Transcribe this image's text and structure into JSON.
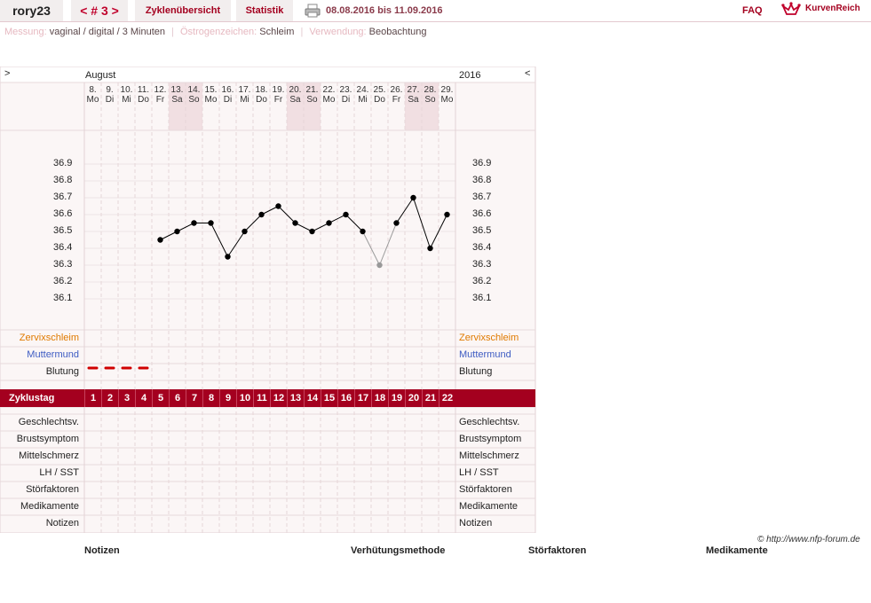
{
  "header": {
    "username": "rory23",
    "cycle_prev": "<",
    "cycle_label": "# 3",
    "cycle_next": ">",
    "tab_overview": "Zyklenübersicht",
    "tab_stats": "Statistik",
    "date_range": "08.08.2016 bis 11.09.2016",
    "faq": "FAQ",
    "brand": "KurvenReich"
  },
  "meta": {
    "measurement_label": "Messung:",
    "measurement_value": "vaginal / digital / 3 Minuten",
    "estrogen_label": "Östrogenzeichen:",
    "estrogen_value": "Schleim",
    "usage_label": "Verwendung:",
    "usage_value": "Beobachtung"
  },
  "chart": {
    "nav_left": ">",
    "nav_right": "<",
    "month": "August",
    "year": "2016",
    "days": [
      {
        "d": "8.",
        "w": "Mo",
        "we": false
      },
      {
        "d": "9.",
        "w": "Di",
        "we": false
      },
      {
        "d": "10.",
        "w": "Mi",
        "we": false
      },
      {
        "d": "11.",
        "w": "Do",
        "we": false
      },
      {
        "d": "12.",
        "w": "Fr",
        "we": false
      },
      {
        "d": "13.",
        "w": "Sa",
        "we": true
      },
      {
        "d": "14.",
        "w": "So",
        "we": true
      },
      {
        "d": "15.",
        "w": "Mo",
        "we": false
      },
      {
        "d": "16.",
        "w": "Di",
        "we": false
      },
      {
        "d": "17.",
        "w": "Mi",
        "we": false
      },
      {
        "d": "18.",
        "w": "Do",
        "we": false
      },
      {
        "d": "19.",
        "w": "Fr",
        "we": false
      },
      {
        "d": "20.",
        "w": "Sa",
        "we": true
      },
      {
        "d": "21.",
        "w": "So",
        "we": true
      },
      {
        "d": "22.",
        "w": "Mo",
        "we": false
      },
      {
        "d": "23.",
        "w": "Di",
        "we": false
      },
      {
        "d": "24.",
        "w": "Mi",
        "we": false
      },
      {
        "d": "25.",
        "w": "Do",
        "we": false
      },
      {
        "d": "26.",
        "w": "Fr",
        "we": false
      },
      {
        "d": "27.",
        "w": "Sa",
        "we": true
      },
      {
        "d": "28.",
        "w": "So",
        "we": true
      },
      {
        "d": "29.",
        "w": "Mo",
        "we": false
      }
    ],
    "temp_ticks": [
      "36.9",
      "36.8",
      "36.7",
      "36.6",
      "36.5",
      "36.4",
      "36.3",
      "36.2",
      "36.1"
    ],
    "temperatures": [
      null,
      null,
      null,
      null,
      36.45,
      36.5,
      36.55,
      36.55,
      36.35,
      36.5,
      36.6,
      36.65,
      36.55,
      36.5,
      36.55,
      36.6,
      36.5,
      36.3,
      36.55,
      36.7,
      36.4,
      36.6
    ],
    "excluded_index": 17,
    "bleeding_days": [
      0,
      1,
      2,
      3
    ],
    "cycle_days": [
      "1",
      "2",
      "3",
      "4",
      "5",
      "6",
      "7",
      "8",
      "9",
      "10",
      "11",
      "12",
      "13",
      "14",
      "15",
      "16",
      "17",
      "18",
      "19",
      "20",
      "21",
      "22"
    ],
    "zyklustag_label": "Zyklustag",
    "labels_top": [
      {
        "text": "Zervixschleim",
        "color": "#e07a00"
      },
      {
        "text": "Muttermund",
        "color": "#3d5bc2"
      },
      {
        "text": "Blutung",
        "color": "#222222"
      }
    ],
    "labels_bottom": [
      "Geschlechtsv.",
      "Brustsymptom",
      "Mittelschmerz",
      "LH / SST",
      "Störfaktoren",
      "Medikamente",
      "Notizen"
    ],
    "colors": {
      "accent": "#a4001f",
      "bleeding": "#d00000",
      "point": "#000000",
      "excluded_point": "#999999"
    }
  },
  "footer": {
    "copyright": "© http://www.nfp-forum.de",
    "col_notes": "Notizen",
    "col_method": "Verhütungsmethode",
    "col_disturb": "Störfaktoren",
    "col_meds": "Medikamente"
  }
}
